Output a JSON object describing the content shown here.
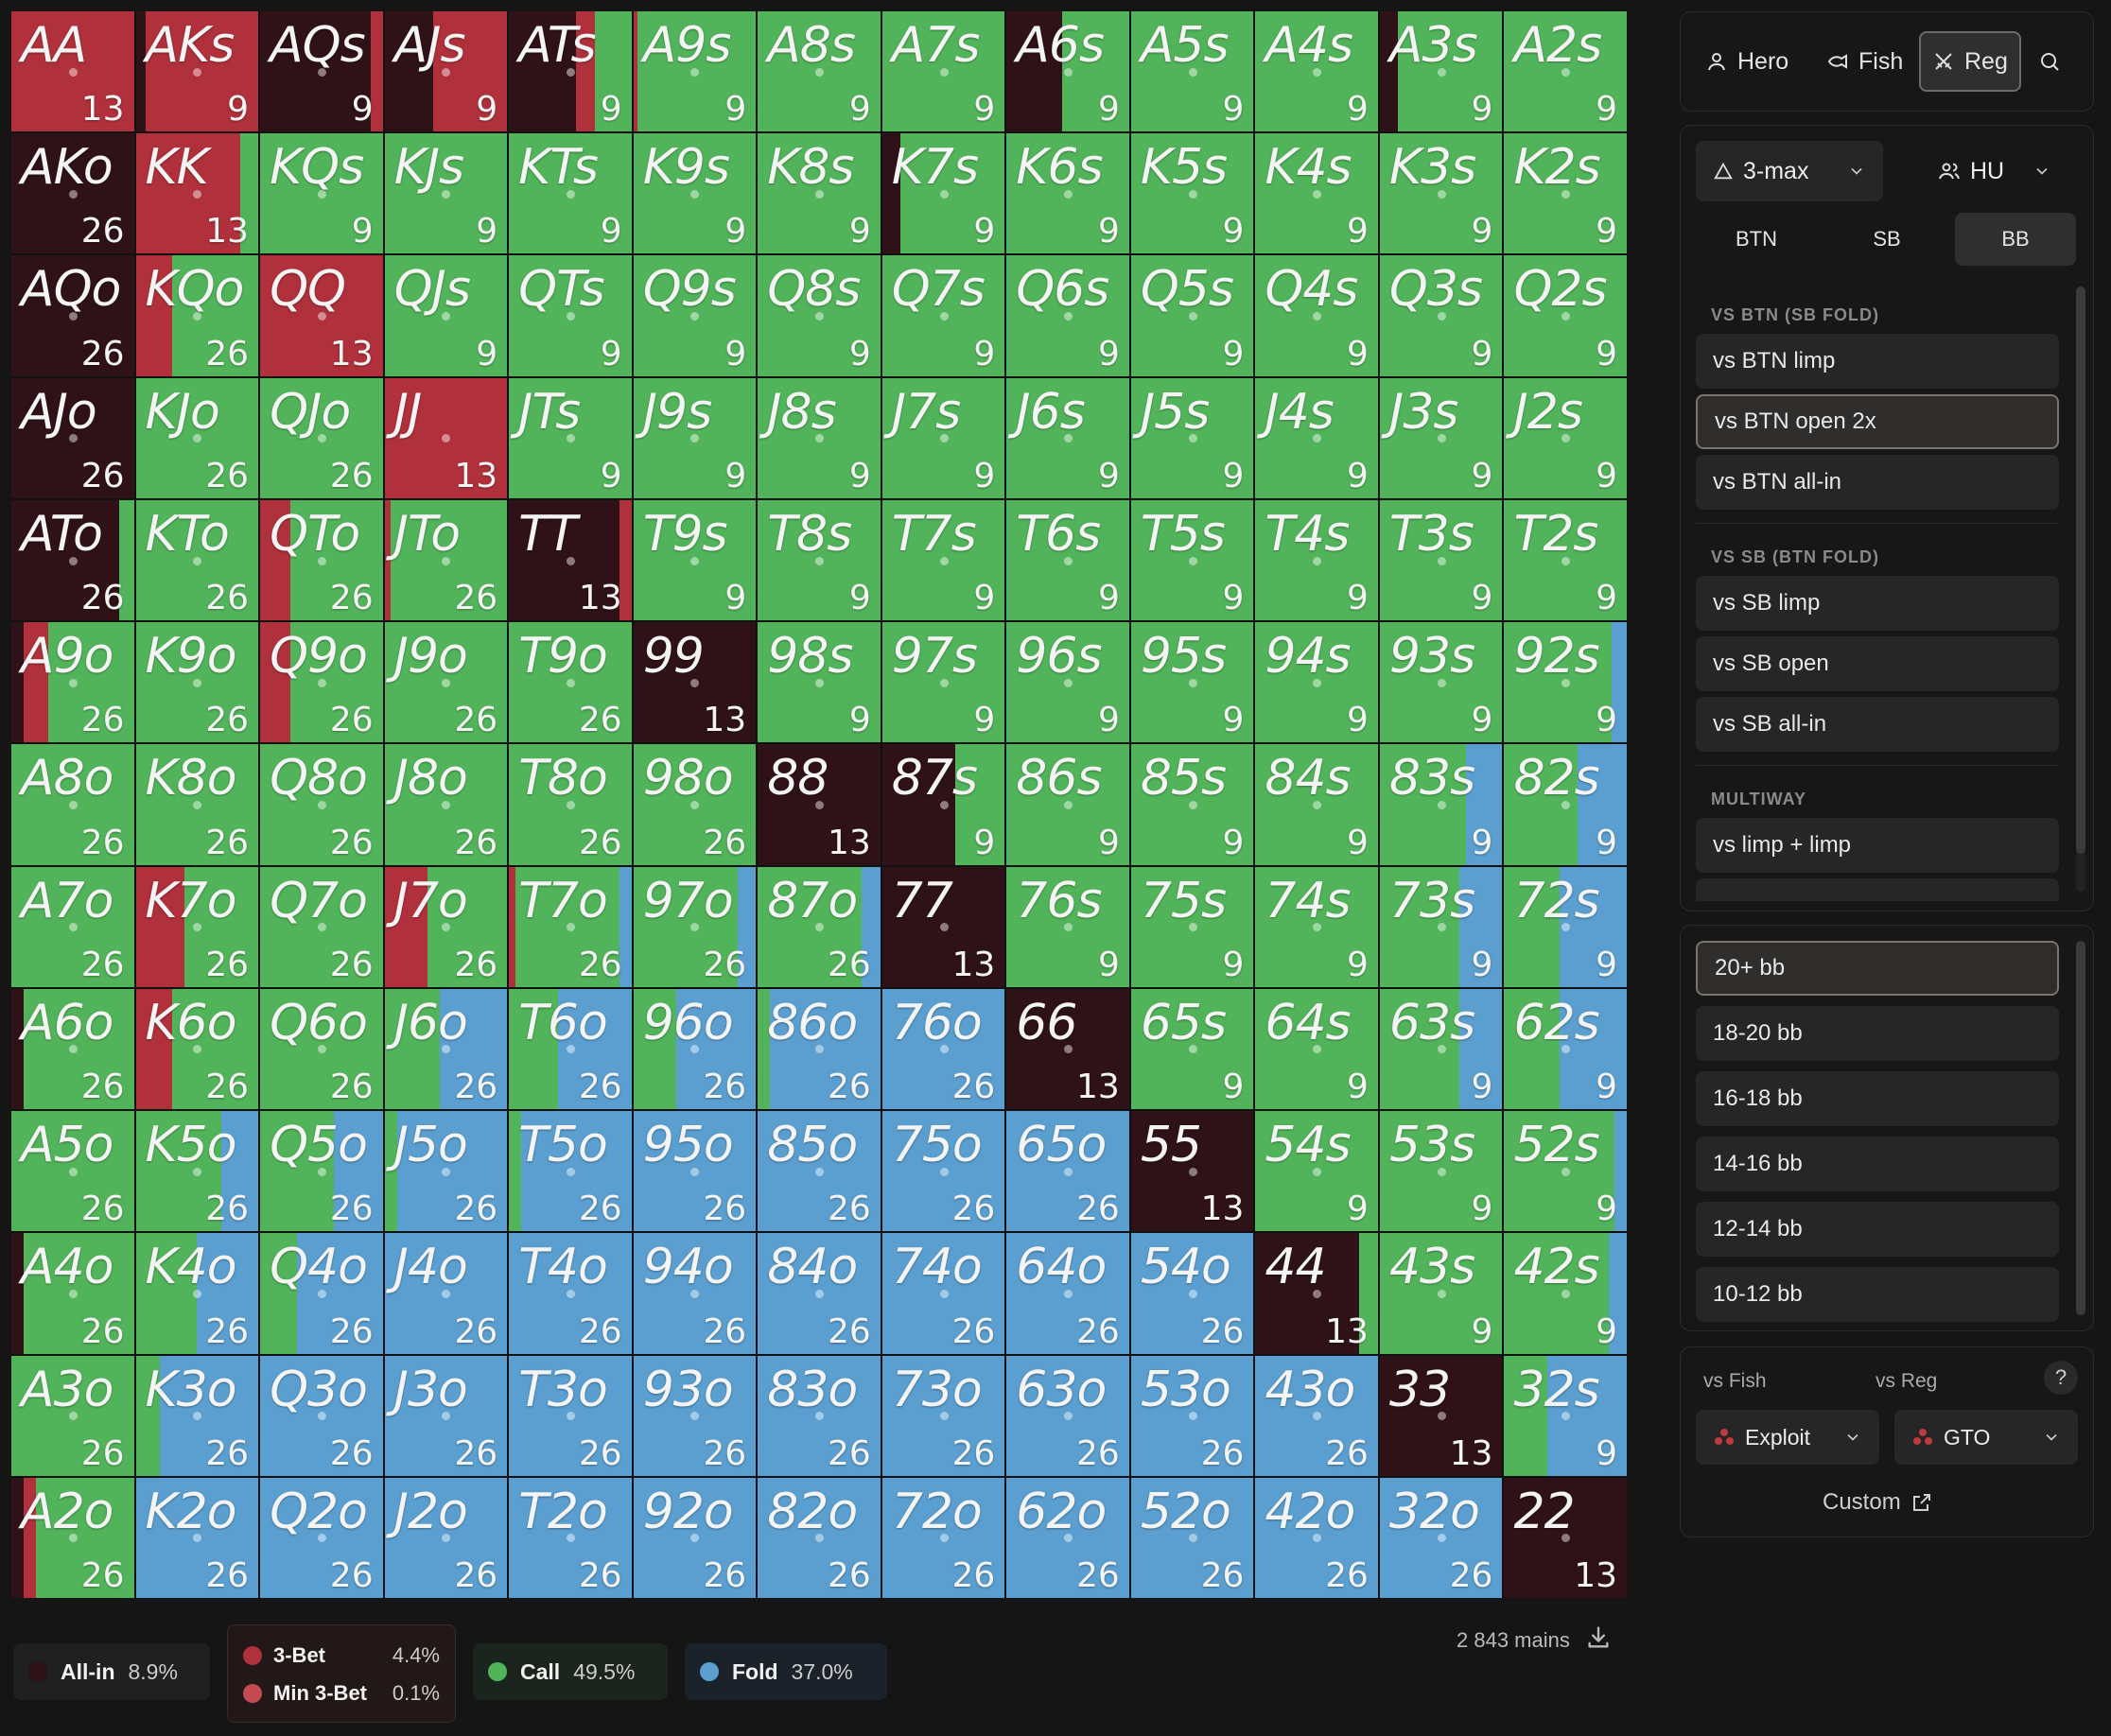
{
  "grid": {
    "ranks": [
      "A",
      "K",
      "Q",
      "J",
      "T",
      "9",
      "8",
      "7",
      "6",
      "5",
      "4",
      "3",
      "2"
    ],
    "combos": {
      "pair": "13",
      "suited": "9",
      "offsuit": "26"
    }
  },
  "colors": {
    "allin": "#2f1218",
    "threebet": "#b0313b",
    "minthreebet": "#c24a50",
    "call": "#52b45a",
    "fold": "#5b9fd0"
  },
  "legend": {
    "allin": {
      "label": "All-in",
      "value": "8.9%"
    },
    "threebet": {
      "label": "3-Bet",
      "value": "4.4%"
    },
    "minthreebet": {
      "label": "Min 3-Bet",
      "value": "0.1%"
    },
    "call": {
      "label": "Call",
      "value": "49.5%"
    },
    "fold": {
      "label": "Fold",
      "value": "37.0%"
    },
    "mains": "2 843 mains"
  },
  "player_tabs": [
    {
      "label": "Hero",
      "icon": "user-icon"
    },
    {
      "label": "Fish",
      "icon": "fish-icon"
    },
    {
      "label": "Reg",
      "icon": "swords-icon"
    }
  ],
  "table": {
    "format": "3-max",
    "players": "HU",
    "positions": [
      "BTN",
      "SB",
      "BB"
    ],
    "active_position": "BB"
  },
  "spots": {
    "section_btn": "VS BTN (SB FOLD)",
    "btn_items": [
      "vs BTN limp",
      "vs BTN open 2x",
      "vs BTN all-in"
    ],
    "section_sb": "VS SB (BTN FOLD)",
    "sb_items": [
      "vs SB limp",
      "vs SB open",
      "vs SB all-in"
    ],
    "section_multi": "MULTIWAY",
    "multi_items": [
      "vs limp + limp"
    ],
    "active": "vs BTN open 2x"
  },
  "stacks": {
    "items": [
      "20+ bb",
      "18-20 bb",
      "16-18 bb",
      "14-16 bb",
      "12-14 bb",
      "10-12 bb"
    ],
    "active": "20+ bb"
  },
  "strategy": {
    "vs_fish_label": "vs Fish",
    "vs_reg_label": "vs Reg",
    "help": "?",
    "vs_fish_value": "Exploit",
    "vs_reg_value": "GTO",
    "custom_label": "Custom"
  },
  "range": {
    "AA": {
      "threebet": 1
    },
    "AKs": {
      "threebet": 0.92,
      "allin": 0.08
    },
    "AQs": {
      "allin": 0.9,
      "threebet": 0.1
    },
    "AJs": {
      "allin": 0.4,
      "threebet": 0.6
    },
    "ATs": {
      "allin": 0.55,
      "threebet": 0.15,
      "call": 0.3
    },
    "A9s": {
      "threebet": 0.03,
      "call": 0.97
    },
    "A6s": {
      "allin": 0.45,
      "call": 0.55
    },
    "A3s": {
      "allin": 0.15,
      "call": 0.85
    },
    "AKo": {
      "allin": 1
    },
    "KK": {
      "threebet": 0.85,
      "call": 0.15
    },
    "K7s": {
      "allin": 0.15,
      "call": 0.85
    },
    "AQo": {
      "allin": 1
    },
    "KQo": {
      "threebet": 0.3,
      "call": 0.7
    },
    "QQ": {
      "threebet": 1
    },
    "AJo": {
      "allin": 1
    },
    "JJ": {
      "threebet": 1
    },
    "ATo": {
      "allin": 0.88,
      "call": 0.12
    },
    "QTo": {
      "threebet": 0.25,
      "call": 0.75
    },
    "JTo": {
      "threebet": 0.05,
      "call": 0.95
    },
    "TT": {
      "allin": 0.9,
      "threebet": 0.1
    },
    "A9o": {
      "allin": 0.1,
      "threebet": 0.2,
      "call": 0.7
    },
    "Q9o": {
      "threebet": 0.25,
      "call": 0.75
    },
    "99": {
      "allin": 1
    },
    "92s": {
      "call": 0.88,
      "fold": 0.12
    },
    "88": {
      "allin": 1
    },
    "87s": {
      "allin": 0.6,
      "call": 0.4
    },
    "83s": {
      "call": 0.7,
      "fold": 0.3
    },
    "82s": {
      "call": 0.6,
      "fold": 0.4
    },
    "K7o": {
      "threebet": 0.4,
      "call": 0.6
    },
    "J7o": {
      "threebet": 0.35,
      "call": 0.65
    },
    "T7o": {
      "threebet": 0.05,
      "call": 0.85,
      "fold": 0.1
    },
    "97o": {
      "call": 0.85,
      "fold": 0.15
    },
    "87o": {
      "call": 0.85,
      "fold": 0.15
    },
    "77": {
      "allin": 1
    },
    "73s": {
      "call": 0.65,
      "fold": 0.35
    },
    "72s": {
      "call": 0.45,
      "fold": 0.55
    },
    "A6o": {
      "allin": 0.1,
      "call": 0.9
    },
    "K6o": {
      "threebet": 0.3,
      "call": 0.7
    },
    "J6o": {
      "call": 0.45,
      "fold": 0.55
    },
    "T6o": {
      "call": 0.4,
      "fold": 0.6
    },
    "96o": {
      "call": 0.35,
      "fold": 0.65
    },
    "86o": {
      "call": 0.1,
      "fold": 0.9
    },
    "76o": {
      "fold": 1
    },
    "66": {
      "allin": 1
    },
    "63s": {
      "call": 0.65,
      "fold": 0.35
    },
    "62s": {
      "call": 0.45,
      "fold": 0.55
    },
    "K5o": {
      "call": 0.7,
      "fold": 0.3
    },
    "Q5o": {
      "call": 0.6,
      "fold": 0.4
    },
    "J5o": {
      "call": 0.1,
      "fold": 0.9
    },
    "T5o": {
      "call": 0.1,
      "fold": 0.9
    },
    "95o": {
      "fold": 1
    },
    "85o": {
      "fold": 1
    },
    "75o": {
      "fold": 1
    },
    "65o": {
      "fold": 1
    },
    "55": {
      "allin": 1
    },
    "52s": {
      "call": 0.9,
      "fold": 0.1
    },
    "A4o": {
      "allin": 0.1,
      "call": 0.9
    },
    "K4o": {
      "call": 0.5,
      "fold": 0.5
    },
    "Q4o": {
      "call": 0.3,
      "fold": 0.7
    },
    "J4o": {
      "fold": 1
    },
    "T4o": {
      "fold": 1
    },
    "94o": {
      "fold": 1
    },
    "84o": {
      "fold": 1
    },
    "74o": {
      "fold": 1
    },
    "64o": {
      "fold": 1
    },
    "54o": {
      "fold": 1
    },
    "44": {
      "allin": 0.85,
      "call": 0.15
    },
    "42s": {
      "call": 0.85,
      "fold": 0.15
    },
    "K3o": {
      "call": 0.2,
      "fold": 0.8
    },
    "Q3o": {
      "fold": 1
    },
    "J3o": {
      "fold": 1
    },
    "T3o": {
      "fold": 1
    },
    "93o": {
      "fold": 1
    },
    "83o": {
      "fold": 1
    },
    "73o": {
      "fold": 1
    },
    "63o": {
      "fold": 1
    },
    "53o": {
      "fold": 1
    },
    "43o": {
      "fold": 1
    },
    "33": {
      "allin": 1
    },
    "32s": {
      "call": 0.35,
      "fold": 0.65
    },
    "A2o": {
      "allin": 0.1,
      "threebet": 0.1,
      "call": 0.8
    },
    "K2o": {
      "fold": 1
    },
    "Q2o": {
      "fold": 1
    },
    "J2o": {
      "fold": 1
    },
    "T2o": {
      "fold": 1
    },
    "92o": {
      "fold": 1
    },
    "82o": {
      "fold": 1
    },
    "72o": {
      "fold": 1
    },
    "62o": {
      "fold": 1
    },
    "52o": {
      "fold": 1
    },
    "42o": {
      "fold": 1
    },
    "32o": {
      "fold": 1
    },
    "22": {
      "allin": 1
    }
  }
}
